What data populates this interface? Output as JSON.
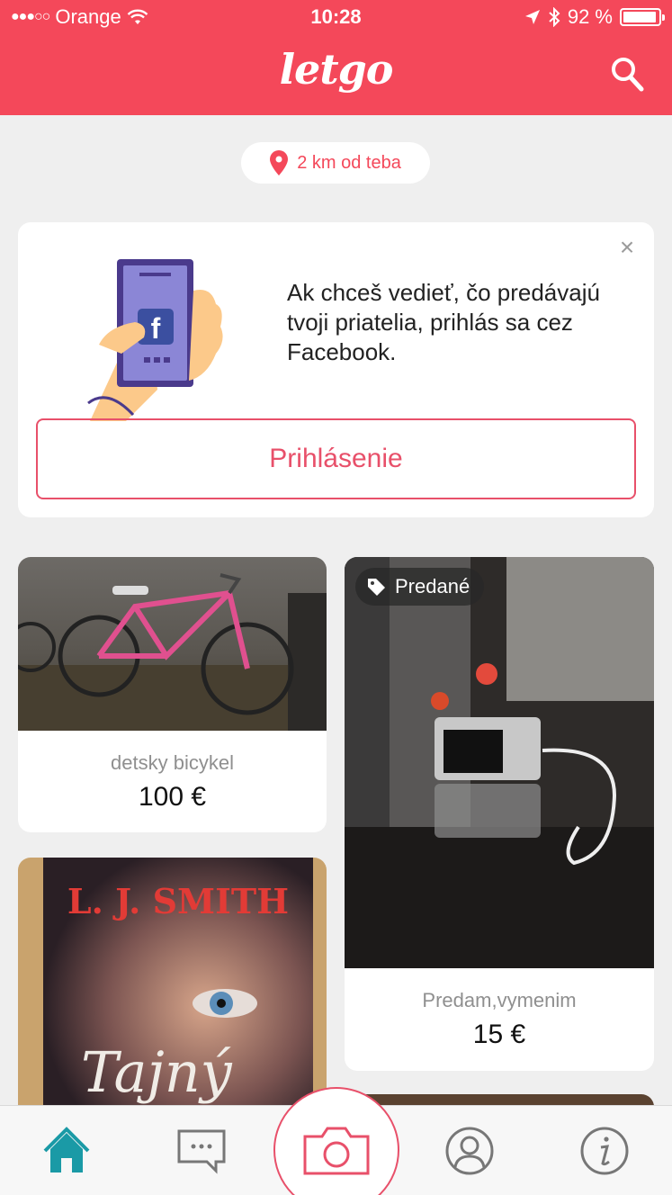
{
  "status_bar": {
    "carrier": "Orange",
    "time": "10:28",
    "battery": "92 %"
  },
  "header": {
    "logo": "letgo",
    "icons": [
      "search-icon"
    ]
  },
  "location": {
    "distance_label": "2 km od teba"
  },
  "facebook_card": {
    "message": "Ak chceš vedieť, čo predávajú tvoji priatelia, prihlás sa cez Facebook.",
    "login_button": "Prihlásenie",
    "close_icon": "close-icon"
  },
  "products": [
    {
      "title": "detsky bicykel",
      "price": "100 €",
      "image": "bicycle-photo"
    },
    {
      "title": "Predam,vymenim",
      "price": "15 €",
      "image": "camera-photo",
      "badge": "Predané"
    },
    {
      "title": "",
      "price": "",
      "image": "book-photo",
      "cover_author": "L. J. SMITH",
      "cover_title": "Tajný"
    }
  ],
  "tabbar": {
    "tabs": [
      "home-icon",
      "chat-icon",
      "camera-icon",
      "profile-icon",
      "info-icon"
    ]
  },
  "colors": {
    "brand": "#f4485a",
    "accent_border": "#e8506a",
    "tab_active": "#1a9aa6",
    "background": "#efefef"
  }
}
